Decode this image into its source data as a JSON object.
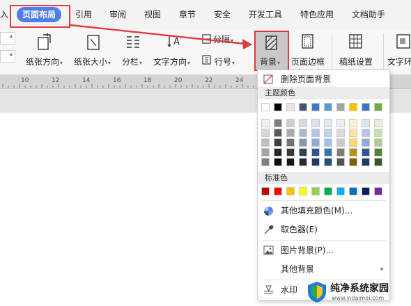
{
  "tabs": {
    "partial": "入",
    "page_layout": "页面布局",
    "reference": "引用",
    "review": "审阅",
    "view": "视图",
    "chapter": "章节",
    "security": "安全",
    "dev_tools": "开发工具",
    "special": "特色应用",
    "doc_assistant": "文档助手"
  },
  "ribbon": {
    "paper_direction": "纸张方向",
    "paper_size": "纸张大小",
    "columns": "分栏",
    "text_direction": "文字方向",
    "separator": "分隔",
    "line_number": "行号",
    "background": "背景",
    "page_border": "页面边框",
    "manuscript": "稿纸设置",
    "text_wrap": "文字环"
  },
  "ruler": {
    "ticks": [
      "10",
      "12",
      "14",
      "16",
      "18",
      "20",
      "22",
      "24",
      "26"
    ]
  },
  "menu": {
    "remove_bg": "删除页面背景",
    "theme_colors_label": "主题颜色",
    "theme_top": [
      "#ffffff",
      "#000000",
      "#e7e6e6",
      "#44546a",
      "#4472c4",
      "#5b9bd5",
      "#a5a5a5",
      "#ffc000",
      "#4472c4",
      "#70ad47"
    ],
    "theme_shades": [
      [
        "#f2f2f2",
        "#7f7f7f",
        "#d0cece",
        "#d6dce4",
        "#d9e2f3",
        "#deebf6",
        "#ededed",
        "#fff2cc",
        "#dae3f3",
        "#e2efd9"
      ],
      [
        "#d8d8d8",
        "#595959",
        "#aeaaaa",
        "#adb9ca",
        "#b4c6e7",
        "#bdd7ee",
        "#dbdbdb",
        "#fee599",
        "#b4c6e7",
        "#c5e0b3"
      ],
      [
        "#bfbfbf",
        "#3f3f3f",
        "#757070",
        "#8496b0",
        "#8eaadb",
        "#9dc3e6",
        "#c9c9c9",
        "#ffd965",
        "#8eaadb",
        "#a8d08d"
      ],
      [
        "#a5a5a5",
        "#262626",
        "#3a3838",
        "#323f4f",
        "#2f5496",
        "#2e75b5",
        "#7b7b7b",
        "#bf9000",
        "#2f5496",
        "#538135"
      ],
      [
        "#7f7f7f",
        "#0c0c0c",
        "#171616",
        "#222a35",
        "#1f3864",
        "#1e4e79",
        "#525252",
        "#7f6000",
        "#1f3864",
        "#375623"
      ]
    ],
    "standard_label": "标准色",
    "standard_colors": [
      "#c00000",
      "#ff0000",
      "#ffc000",
      "#ffff00",
      "#92d050",
      "#00b050",
      "#00b0f0",
      "#0070c0",
      "#002060",
      "#7030a0"
    ],
    "more_fill": "其他填充颜色(M)...",
    "eyedropper": "取色器(E)",
    "picture_bg": "图片背景(P)...",
    "other_bg": "其他背景",
    "watermark_item": "水印"
  },
  "site_watermark": {
    "title": "纯净系统家园",
    "url": "www.yidaimei.com"
  }
}
